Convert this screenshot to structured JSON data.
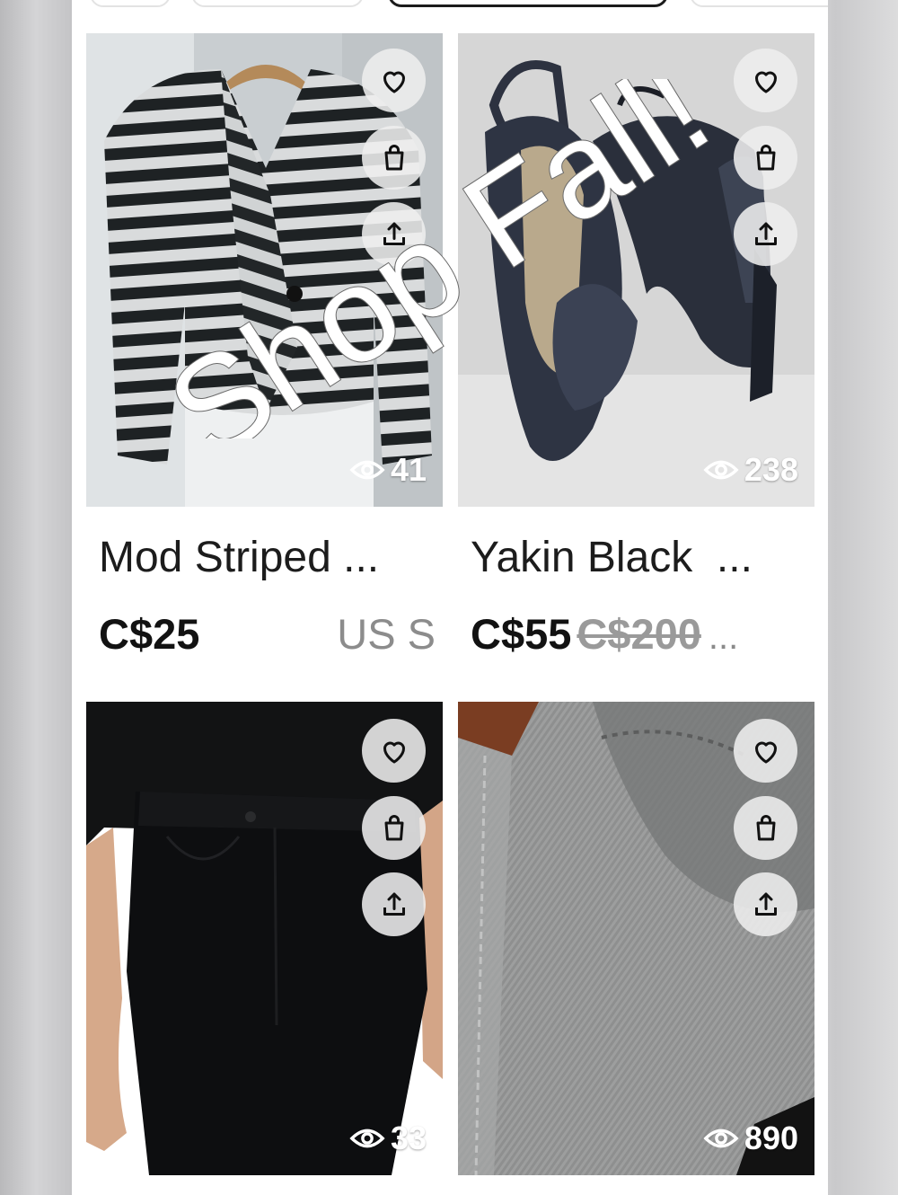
{
  "overlay_text": "Shop Fall!",
  "listings": [
    {
      "title": "Mod Striped ...",
      "price": "C$25",
      "original_price": "",
      "size": "US S",
      "extra": "",
      "views": "41"
    },
    {
      "title": "Yakin Black  ...",
      "price": "C$55",
      "original_price": "C$200",
      "size": "",
      "extra": "...",
      "views": "238"
    },
    {
      "title": "",
      "price": "",
      "original_price": "",
      "size": "",
      "extra": "",
      "views": "33"
    },
    {
      "title": "",
      "price": "",
      "original_price": "",
      "size": "",
      "extra": "",
      "views": "890"
    }
  ],
  "icons": {
    "like": "heart-icon",
    "bundle": "shopping-bag-icon",
    "share": "share-icon",
    "views": "eye-icon"
  },
  "colors": {
    "text": "#1c1c1c",
    "muted": "#8c8c8c",
    "button_bg": "#eeeeee"
  }
}
